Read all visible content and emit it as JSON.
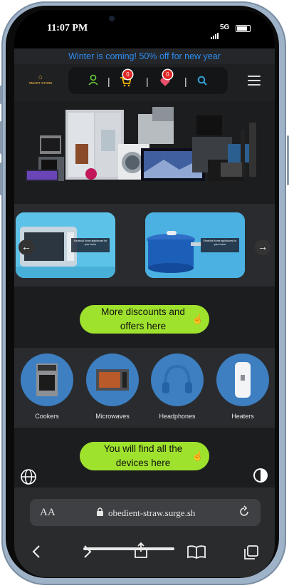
{
  "status": {
    "time": "11:07 PM",
    "network": "5G"
  },
  "promo": {
    "text": "Winter is coming! 50% off for new year"
  },
  "header": {
    "logo_text": "SMART STORE",
    "cart_count": "0",
    "wishlist_count": "0"
  },
  "banners": [
    {
      "label": "Electrical home appliances for your home",
      "image": "microwave-oven"
    },
    {
      "label": "Electrical home appliances for your home",
      "image": "cooking-pot"
    }
  ],
  "cta_discounts": {
    "label": "More discounts and offers here"
  },
  "categories": [
    {
      "label": "Cookers",
      "icon": "cooker-icon"
    },
    {
      "label": "Microwaves",
      "icon": "microwave-icon"
    },
    {
      "label": "Headphones",
      "icon": "headphones-icon"
    },
    {
      "label": "Heaters",
      "icon": "heater-icon"
    }
  ],
  "cta_devices": {
    "label": "You will find all the devices here"
  },
  "browser": {
    "aa_label": "AA",
    "url": "obedient-straw.surge.sh"
  },
  "colors": {
    "accent_green": "#9fe22d",
    "promo_blue": "#2e8df0",
    "category_blue": "#3d7fc1",
    "badge_red": "#e02424"
  }
}
